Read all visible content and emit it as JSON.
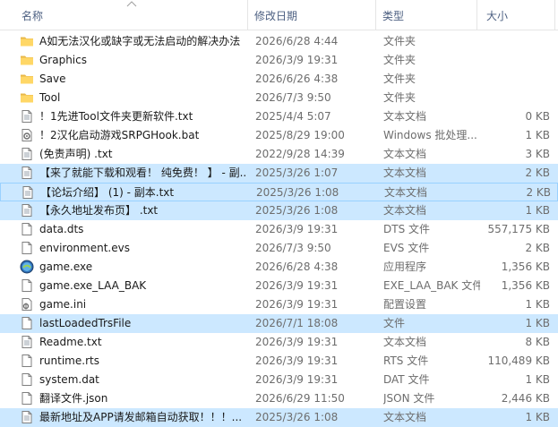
{
  "columns": {
    "name": "名称",
    "date": "修改日期",
    "type": "类型",
    "size": "大小"
  },
  "files": [
    {
      "name": "A如无法汉化或缺字或无法启动的解决办法",
      "date": "2026/6/28 4:44",
      "type": "文件夹",
      "size": "",
      "icon": "folder-icon",
      "selected": false
    },
    {
      "name": "Graphics",
      "date": "2026/3/9 19:31",
      "type": "文件夹",
      "size": "",
      "icon": "folder-icon",
      "selected": false
    },
    {
      "name": "Save",
      "date": "2026/6/26 4:38",
      "type": "文件夹",
      "size": "",
      "icon": "folder-icon",
      "selected": false
    },
    {
      "name": "Tool",
      "date": "2026/7/3 9:50",
      "type": "文件夹",
      "size": "",
      "icon": "folder-icon",
      "selected": false
    },
    {
      "name": "！1先进Tool文件夹更新软件.txt",
      "date": "2025/4/4 5:07",
      "type": "文本文档",
      "size": "0 KB",
      "icon": "text-file-icon",
      "selected": false
    },
    {
      "name": "！2汉化启动游戏SRPGHook.bat",
      "date": "2025/8/29 19:00",
      "type": "Windows 批处理...",
      "size": "1 KB",
      "icon": "batch-file-icon",
      "selected": false
    },
    {
      "name": "(免责声明) .txt",
      "date": "2022/9/28 14:39",
      "type": "文本文档",
      "size": "3 KB",
      "icon": "text-file-icon",
      "selected": false
    },
    {
      "name": "【来了就能下载和观看！ 纯免费！ 】 - 副...",
      "date": "2025/3/26 1:07",
      "type": "文本文档",
      "size": "2 KB",
      "icon": "text-file-icon",
      "selected": true
    },
    {
      "name": "【论坛介绍】 (1) - 副本.txt",
      "date": "2025/3/26 1:08",
      "type": "文本文档",
      "size": "2 KB",
      "icon": "text-file-icon",
      "selected": true,
      "focus": true
    },
    {
      "name": "【永久地址发布页】 .txt",
      "date": "2025/3/26 1:08",
      "type": "文本文档",
      "size": "1 KB",
      "icon": "text-file-icon",
      "selected": true
    },
    {
      "name": "data.dts",
      "date": "2026/3/9 19:31",
      "type": "DTS 文件",
      "size": "557,175 KB",
      "icon": "blank-file-icon",
      "selected": false
    },
    {
      "name": "environment.evs",
      "date": "2026/7/3 9:50",
      "type": "EVS 文件",
      "size": "2 KB",
      "icon": "blank-file-icon",
      "selected": false
    },
    {
      "name": "game.exe",
      "date": "2026/6/28 4:38",
      "type": "应用程序",
      "size": "1,356 KB",
      "icon": "application-icon",
      "selected": false
    },
    {
      "name": "game.exe_LAA_BAK",
      "date": "2026/3/9 19:31",
      "type": "EXE_LAA_BAK 文件",
      "size": "1,356 KB",
      "icon": "blank-file-icon",
      "selected": false
    },
    {
      "name": "game.ini",
      "date": "2026/3/9 19:31",
      "type": "配置设置",
      "size": "1 KB",
      "icon": "settings-file-icon",
      "selected": false
    },
    {
      "name": "lastLoadedTrsFile",
      "date": "2026/7/1 18:08",
      "type": "文件",
      "size": "1 KB",
      "icon": "blank-file-icon",
      "selected": true
    },
    {
      "name": "Readme.txt",
      "date": "2026/3/9 19:31",
      "type": "文本文档",
      "size": "8 KB",
      "icon": "text-file-icon",
      "selected": false
    },
    {
      "name": "runtime.rts",
      "date": "2026/3/9 19:31",
      "type": "RTS 文件",
      "size": "110,489 KB",
      "icon": "blank-file-icon",
      "selected": false
    },
    {
      "name": "system.dat",
      "date": "2026/3/9 19:31",
      "type": "DAT 文件",
      "size": "1 KB",
      "icon": "blank-file-icon",
      "selected": false
    },
    {
      "name": "翻译文件.json",
      "date": "2026/6/29 11:50",
      "type": "JSON 文件",
      "size": "2,446 KB",
      "icon": "blank-file-icon",
      "selected": false
    },
    {
      "name": "最新地址及APP请发邮箱自动获取！！！...",
      "date": "2025/3/26 1:08",
      "type": "文本文档",
      "size": "1 KB",
      "icon": "text-file-icon",
      "selected": true
    }
  ]
}
